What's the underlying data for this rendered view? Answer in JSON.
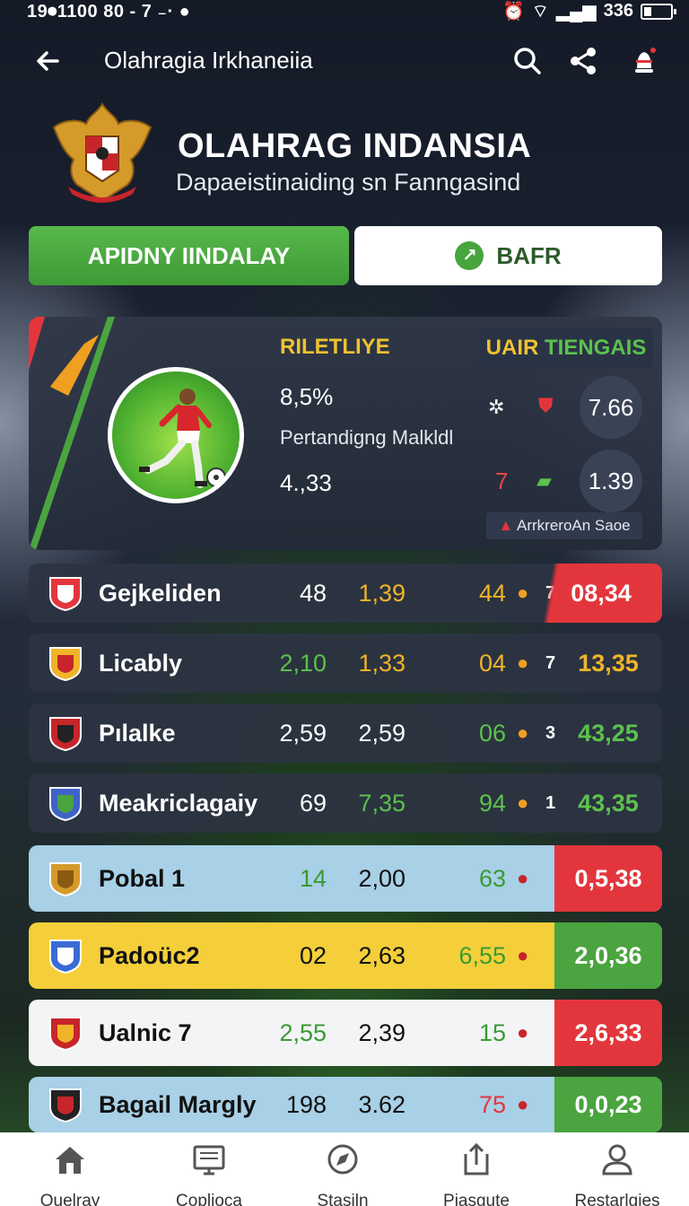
{
  "status_bar": {
    "time": "19⏺1100 80 - 7 ₋· ●",
    "battery_text": "336"
  },
  "app_bar": {
    "title": "Olahragia Irkhaneiia"
  },
  "brand": {
    "title": "OLAHRAG INDANSIA",
    "subtitle": "Dapaeistinaiding sn Fanngasind"
  },
  "buttons": {
    "primary": "APIDNY IINDALAY",
    "secondary": "BAFR"
  },
  "feature": {
    "label": "RILETLIYE",
    "percent": "8,5%",
    "subtitle": "Pertandigng Malkldl",
    "value": "4.,33",
    "right_label_a": "UAIR",
    "right_label_b": " TIENGAIS",
    "score1": "7.66",
    "score2": "1.39",
    "red_num": "7",
    "chip": "ArrkreroАn Saoe"
  },
  "rows": [
    {
      "name": "Gejkeliden",
      "c1": "48",
      "c2": "1,39",
      "c3": "44",
      "num2": "7",
      "badge": "08,34",
      "style": "dark",
      "c1_color": "#ffffff",
      "c2_color": "#f0b429",
      "c3_color": "#f0b429",
      "badge_style": "red",
      "badge_color": "#ffffff"
    },
    {
      "name": "Licably",
      "c1": "2,10",
      "c2": "1,33",
      "c3": "04",
      "num2": "7",
      "badge": "13,35",
      "style": "dark",
      "c1_color": "#5cc14e",
      "c2_color": "#f0b429",
      "c3_color": "#f0b429",
      "badge_style": "none",
      "badge_color": "#f0b429"
    },
    {
      "name": "Pılalke",
      "c1": "2,59",
      "c2": "2,59",
      "c3": "06",
      "num2": "3",
      "badge": "43,25",
      "style": "dark",
      "c1_color": "#ffffff",
      "c2_color": "#ffffff",
      "c3_color": "#5cc14e",
      "badge_style": "none",
      "badge_color": "#5cc14e"
    },
    {
      "name": "Meakriclagaiy",
      "c1": "69",
      "c2": "7,35",
      "c3": "94",
      "num2": "1",
      "badge": "43,35",
      "style": "dark",
      "c1_color": "#ffffff",
      "c2_color": "#5cc14e",
      "c3_color": "#5cc14e",
      "badge_style": "none",
      "badge_color": "#5cc14e"
    },
    {
      "name": "Pobal 1",
      "c1": "14",
      "c2": "2,00",
      "c3": "63",
      "num2": "",
      "badge": "0,5,38",
      "style": "#a8d0e6",
      "c1_color": "#3a9a32",
      "c2_color": "#111111",
      "c3_color": "#3a9a32",
      "badge_style": "redbg",
      "badge_color": "#ffffff"
    },
    {
      "name": "Padoüc2",
      "c1": "02",
      "c2": "2,63",
      "c3": "6,55",
      "num2": "",
      "badge": "2,0,36",
      "style": "#f4cf3a",
      "c1_color": "#111111",
      "c2_color": "#111111",
      "c3_color": "#3a9a32",
      "badge_style": "greenbg",
      "badge_color": "#ffffff"
    },
    {
      "name": "Ualnic 7",
      "c1": "2,55",
      "c2": "2,39",
      "c3": "15",
      "num2": "",
      "badge": "2,6,33",
      "style": "#f3f4f6",
      "c1_color": "#3a9a32",
      "c2_color": "#111111",
      "c3_color": "#3a9a32",
      "badge_style": "redbg",
      "badge_color": "#ffffff"
    },
    {
      "name": "Bagail Margly",
      "c1": "198",
      "c2": "3.62",
      "c3": "75",
      "num2": "",
      "badge": "0,0,23",
      "style": "#a8d0e6",
      "c1_color": "#111111",
      "c2_color": "#111111",
      "c3_color": "#e3363c",
      "badge_style": "greenbg",
      "badge_color": "#ffffff"
    }
  ],
  "bottom_nav": [
    {
      "label": "Ouelray",
      "icon": "home-icon"
    },
    {
      "label": "Coplioca",
      "icon": "tv-icon"
    },
    {
      "label": "Stasiln",
      "icon": "compass-icon"
    },
    {
      "label": "Piasgute",
      "icon": "share-box-icon"
    },
    {
      "label": "Restarlgies",
      "icon": "person-icon"
    }
  ]
}
